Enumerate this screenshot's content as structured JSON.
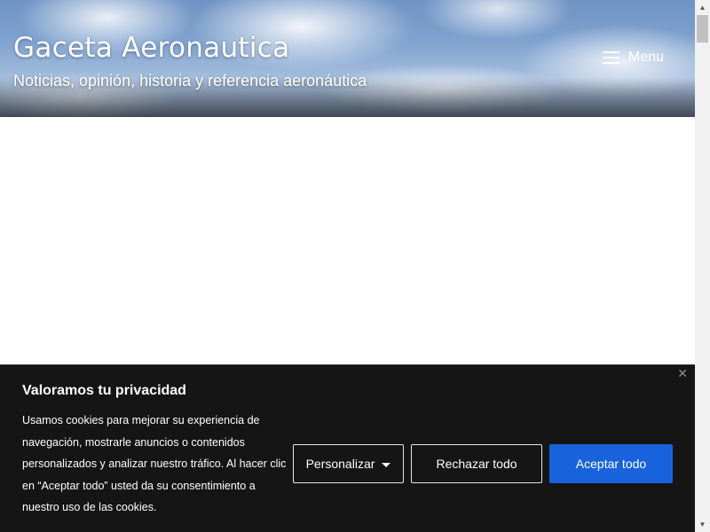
{
  "header": {
    "site_title": "Gaceta Aeronautica",
    "tagline": "Noticias, opinión, historia y referencia aeronáutica",
    "menu_label": "Menu",
    "menu_icon": "hamburger-icon"
  },
  "cookie_banner": {
    "title": "Valoramos tu privacidad",
    "text": "Usamos cookies para mejorar su experiencia de navegación, mostrarle anuncios o contenidos personalizados y analizar nuestro tráfico. Al hacer clic en “Aceptar todo” usted da su consentimiento a nuestro uso de las cookies.",
    "close_symbol": "✕",
    "buttons": {
      "customize": "Personalizar",
      "reject": "Rechazar todo",
      "accept": "Aceptar todo"
    },
    "colors": {
      "background": "#151515",
      "accept": "#1863dc"
    }
  },
  "scrollbar": {
    "up_arrow": "▲",
    "down_arrow": "▼"
  }
}
